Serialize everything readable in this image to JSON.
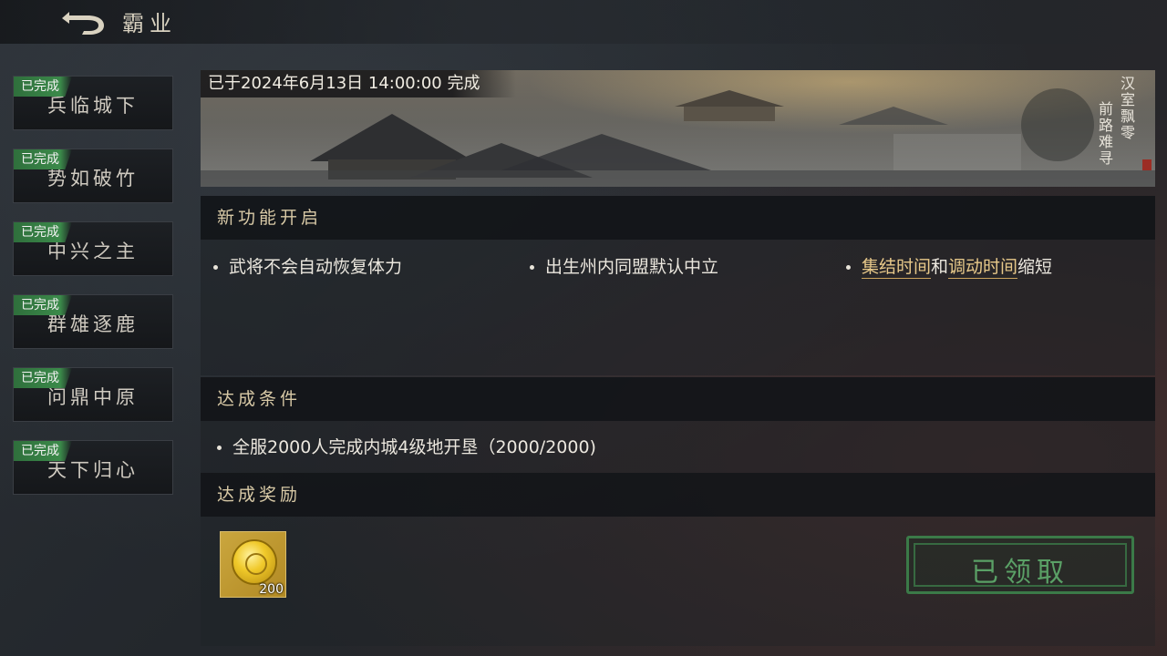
{
  "header": {
    "title": "霸业",
    "back_icon": "back-arrow-icon"
  },
  "sidebar": {
    "items": [
      {
        "badge": "已完成",
        "label": "兵临城下"
      },
      {
        "badge": "已完成",
        "label": "势如破竹"
      },
      {
        "badge": "已完成",
        "label": "中兴之主"
      },
      {
        "badge": "已完成",
        "label": "群雄逐鹿"
      },
      {
        "badge": "已完成",
        "label": "问鼎中原"
      },
      {
        "badge": "已完成",
        "label": "天下归心"
      }
    ]
  },
  "banner": {
    "status": "已于2024年6月13日 14:00:00 完成",
    "poem_line1": "汉室飘零",
    "poem_line2": "前路难寻"
  },
  "features": {
    "title": "新功能开启",
    "items": [
      {
        "text": "武将不会自动恢复体力"
      },
      {
        "text": "出生州内同盟默认中立"
      },
      {
        "hl1": "集结时间",
        "mid": "和",
        "hl2": "调动时间",
        "tail": "缩短"
      }
    ]
  },
  "condition": {
    "title": "达成条件",
    "text": "全服2000人完成内城4级地开垦（2000/2000)"
  },
  "reward": {
    "title": "达成奖励",
    "item_icon": "gold-coin-icon",
    "count": "200",
    "claim_label": "已领取"
  },
  "colors": {
    "accent_gold": "#e8c98a",
    "badge_green": "#3b8a4a",
    "claimed_green": "#5aa066"
  }
}
